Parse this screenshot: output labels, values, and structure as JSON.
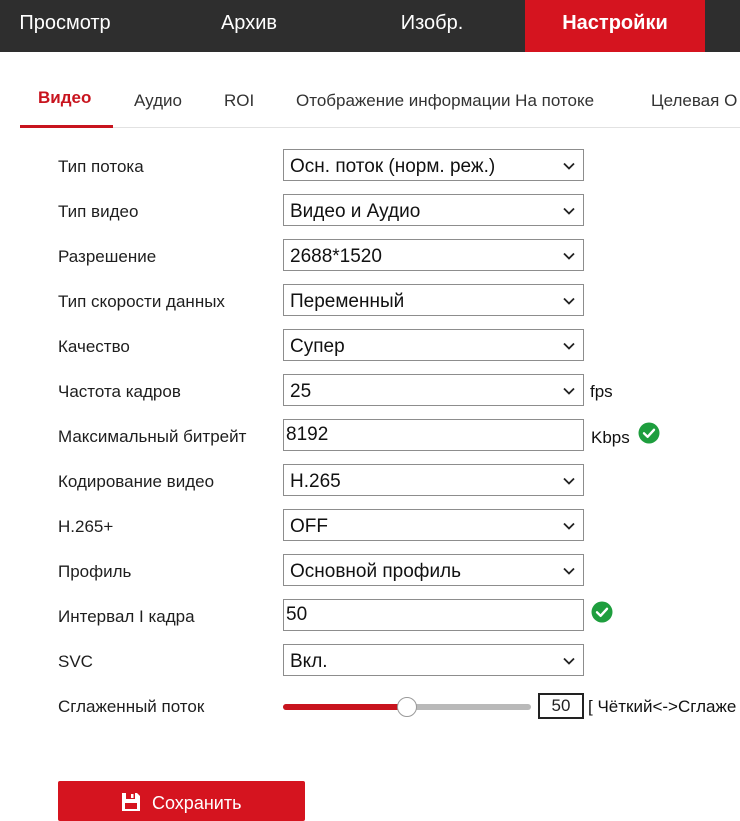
{
  "nav": {
    "items": [
      "Просмотр",
      "Архив",
      "Изобр.",
      "Настройки"
    ],
    "active": 3
  },
  "tabs": {
    "items": [
      "Видео",
      "Аудио",
      "ROI",
      "Отображение информации На потоке",
      "Целевая О"
    ],
    "active": 0
  },
  "form": {
    "stream_type": {
      "label": "Тип потока",
      "value": "Осн. поток (норм. реж.)"
    },
    "video_type": {
      "label": "Тип видео",
      "value": "Видео и Аудио"
    },
    "resolution": {
      "label": "Разрешение",
      "value": "2688*1520"
    },
    "bitrate_type": {
      "label": "Тип скорости данных",
      "value": "Переменный"
    },
    "quality": {
      "label": "Качество",
      "value": "Супер"
    },
    "frame_rate": {
      "label": "Частота кадров",
      "value": "25",
      "unit": "fps"
    },
    "max_bitrate": {
      "label": "Максимальный битрейт",
      "value": "8192",
      "unit": "Kbps"
    },
    "video_encoding": {
      "label": "Кодирование видео",
      "value": "H.265"
    },
    "h265plus": {
      "label": "H.265+",
      "value": "OFF"
    },
    "profile": {
      "label": "Профиль",
      "value": "Основной профиль"
    },
    "i_frame_interval": {
      "label": "Интервал I кадра",
      "value": "50"
    },
    "svc": {
      "label": "SVC",
      "value": "Вкл."
    },
    "smoothing": {
      "label": "Сглаженный поток",
      "value": "50",
      "level": 50,
      "hint": "[ Чёткий<->Сглаже"
    }
  },
  "save": {
    "label": "Сохранить"
  },
  "colors": {
    "accent": "#d5141f",
    "nav_bg": "#2e2e2e",
    "ok": "#1e9e3e"
  },
  "icons": {
    "dropdown": "chevron-down-icon",
    "valid": "check-circle-icon",
    "save": "floppy-disk-icon"
  }
}
